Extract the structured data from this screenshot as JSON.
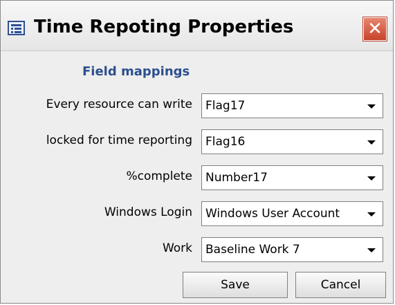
{
  "window": {
    "title": "Time Repoting Properties",
    "close_symbol": "✕"
  },
  "section": {
    "title": "Field mappings"
  },
  "rows": [
    {
      "label": "Every resource can write",
      "value": "Flag17"
    },
    {
      "label": "locked for time reporting",
      "value": "Flag16"
    },
    {
      "label": "%complete",
      "value": "Number17"
    },
    {
      "label": "Windows Login",
      "value": "Windows User Account"
    },
    {
      "label": "Work",
      "value": "Baseline Work 7"
    }
  ],
  "buttons": {
    "save": "Save",
    "cancel": "Cancel"
  },
  "icons": {
    "app": "properties-window-icon",
    "close": "close-icon",
    "dropdown": "chevron-down-icon"
  }
}
